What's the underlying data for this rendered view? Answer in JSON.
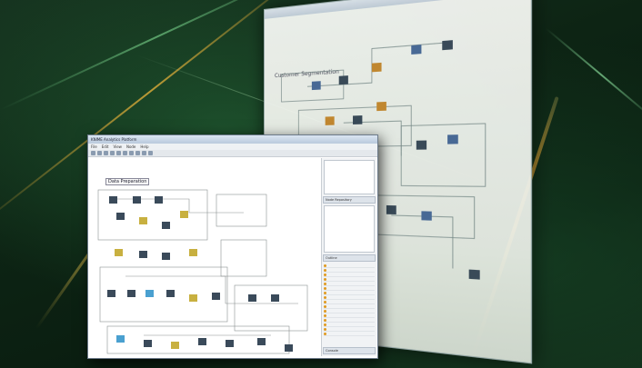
{
  "background": {
    "accent_green": "#1d5a2e",
    "accent_gold": "#f0b040"
  },
  "back_window": {
    "title": "Customer Segmentation",
    "close_icon": "close-icon"
  },
  "front_window": {
    "title": "KNIME Analytics Platform",
    "menu": [
      "File",
      "Edit",
      "View",
      "Node",
      "Help"
    ],
    "canvas_label": "Data Preparation",
    "panel_tabs": [
      "Node Repository",
      "Outline",
      "Console"
    ],
    "panel_rows": 16
  }
}
